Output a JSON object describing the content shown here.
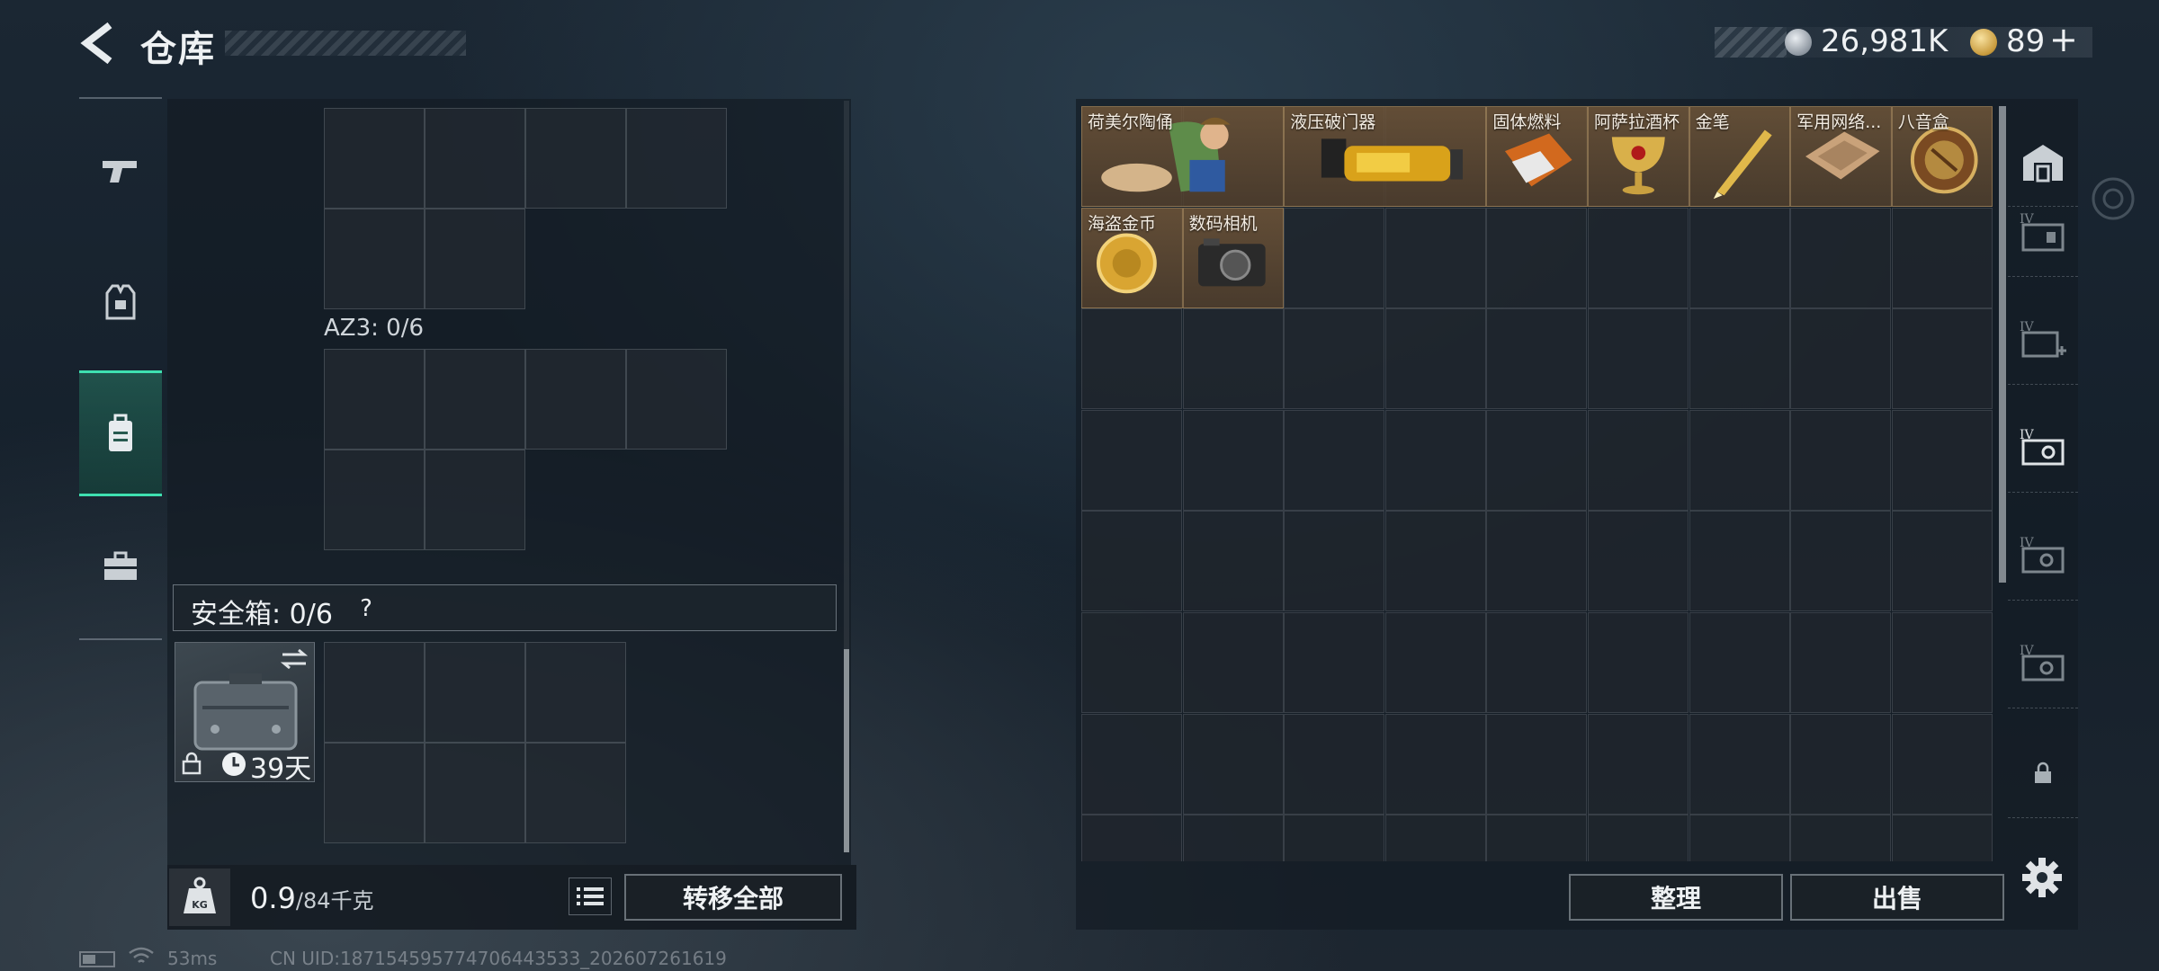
{
  "header": {
    "title": "仓库",
    "currency_silver": "26,981K",
    "currency_gold": "89",
    "plus_label": "+"
  },
  "left_tabs": [
    {
      "icon": "pistol-icon"
    },
    {
      "icon": "vest-icon"
    },
    {
      "icon": "backpack-icon",
      "active": true
    },
    {
      "icon": "briefcase-icon"
    }
  ],
  "inventory": {
    "az3_label": "AZ3: 0/6",
    "safebox_label": "安全箱: 0/6",
    "help_label": "?",
    "safebox_days": "39天",
    "weight_current": "0.9",
    "weight_max": "/84千克",
    "transfer_all_label": "转移全部"
  },
  "storage": {
    "items": [
      {
        "name": "荷美尔陶俑",
        "row": 0,
        "col": 0,
        "w": 2,
        "art": "figurine"
      },
      {
        "name": "液压破门器",
        "row": 0,
        "col": 2,
        "w": 2,
        "art": "breacher"
      },
      {
        "name": "固体燃料",
        "row": 0,
        "col": 4,
        "w": 1,
        "art": "fuel"
      },
      {
        "name": "阿萨拉酒杯",
        "row": 0,
        "col": 5,
        "w": 1,
        "art": "goblet"
      },
      {
        "name": "金笔",
        "row": 0,
        "col": 6,
        "w": 1,
        "art": "pen"
      },
      {
        "name": "军用网络...",
        "row": 0,
        "col": 7,
        "w": 1,
        "art": "board"
      },
      {
        "name": "八音盒",
        "row": 0,
        "col": 8,
        "w": 1,
        "art": "musicbox"
      },
      {
        "name": "海盗金币",
        "row": 1,
        "col": 0,
        "w": 1,
        "art": "coin"
      },
      {
        "name": "数码相机",
        "row": 1,
        "col": 1,
        "w": 1,
        "art": "camera"
      }
    ],
    "sort_label": "整理",
    "sell_label": "出售"
  },
  "right_tabs": [
    {
      "icon": "warehouse-icon",
      "label": ""
    },
    {
      "icon": "storage-tier-1-icon",
      "label": "IV"
    },
    {
      "icon": "storage-tier-2-icon",
      "label": "IV"
    },
    {
      "icon": "storage-tier-3-icon",
      "label": "IV"
    },
    {
      "icon": "storage-tier-4-icon",
      "label": "IV"
    },
    {
      "icon": "storage-tier-5-icon",
      "label": "IV"
    },
    {
      "icon": "lock-icon",
      "label": ""
    }
  ],
  "status": {
    "ping": "53ms",
    "uid": "CN UID:18715459577470644353​3_202607261619"
  }
}
